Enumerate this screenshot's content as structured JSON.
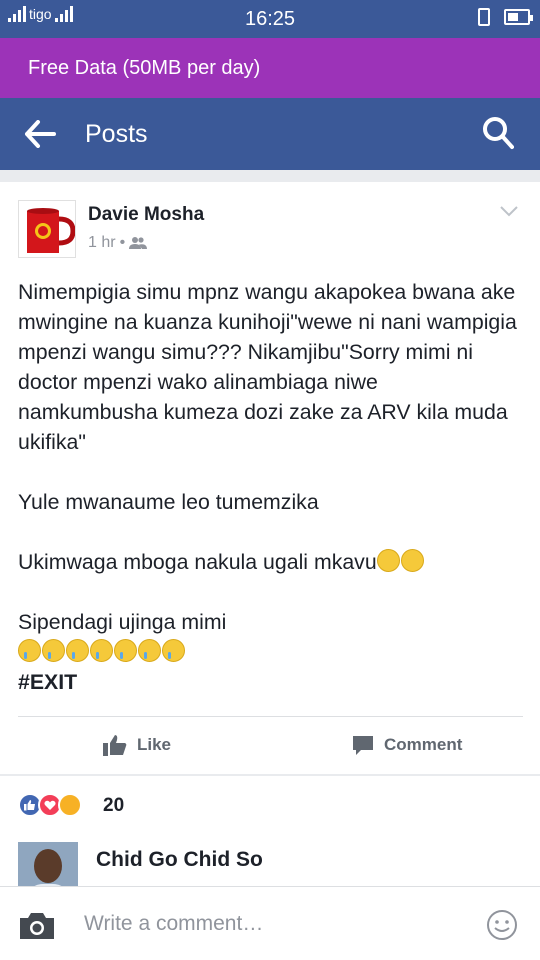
{
  "status_bar": {
    "carrier": "tigo",
    "time": "16:25",
    "colors": {
      "bar": "#3b5998"
    }
  },
  "banner": {
    "label": "Free Data (50MB per day)",
    "color": "#9c33b8"
  },
  "app_bar": {
    "title": "Posts",
    "back_icon": "arrow-left-icon",
    "search_icon": "search-icon"
  },
  "post": {
    "author": "Davie Mosha",
    "time": "1 hr",
    "privacy_icon": "friends-icon",
    "paragraph1": "Nimempigia simu mpnz wangu akapokea bwana ake mwingine na kuanza kunihoji\"wewe ni nani wampigia mpenzi wangu simu??? Nikamjibu\"Sorry mimi ni doctor mpenzi wako alinambiaga niwe namkumbusha kumeza dozi zake za ARV kila muda ukifika\"",
    "paragraph2": "Yule mwanaume leo tumemzika",
    "paragraph3": "Ukimwaga mboga nakula ugali mkavu",
    "paragraph4": "Sipendagi ujinga mimi",
    "hashtag": "#EXIT"
  },
  "actions": {
    "like": "Like",
    "comment": "Comment"
  },
  "reactions": {
    "count": "20",
    "types": [
      "like",
      "love",
      "haha"
    ]
  },
  "comment": {
    "author": "Chid Go Chid So"
  },
  "composer": {
    "placeholder": "Write a comment…"
  }
}
